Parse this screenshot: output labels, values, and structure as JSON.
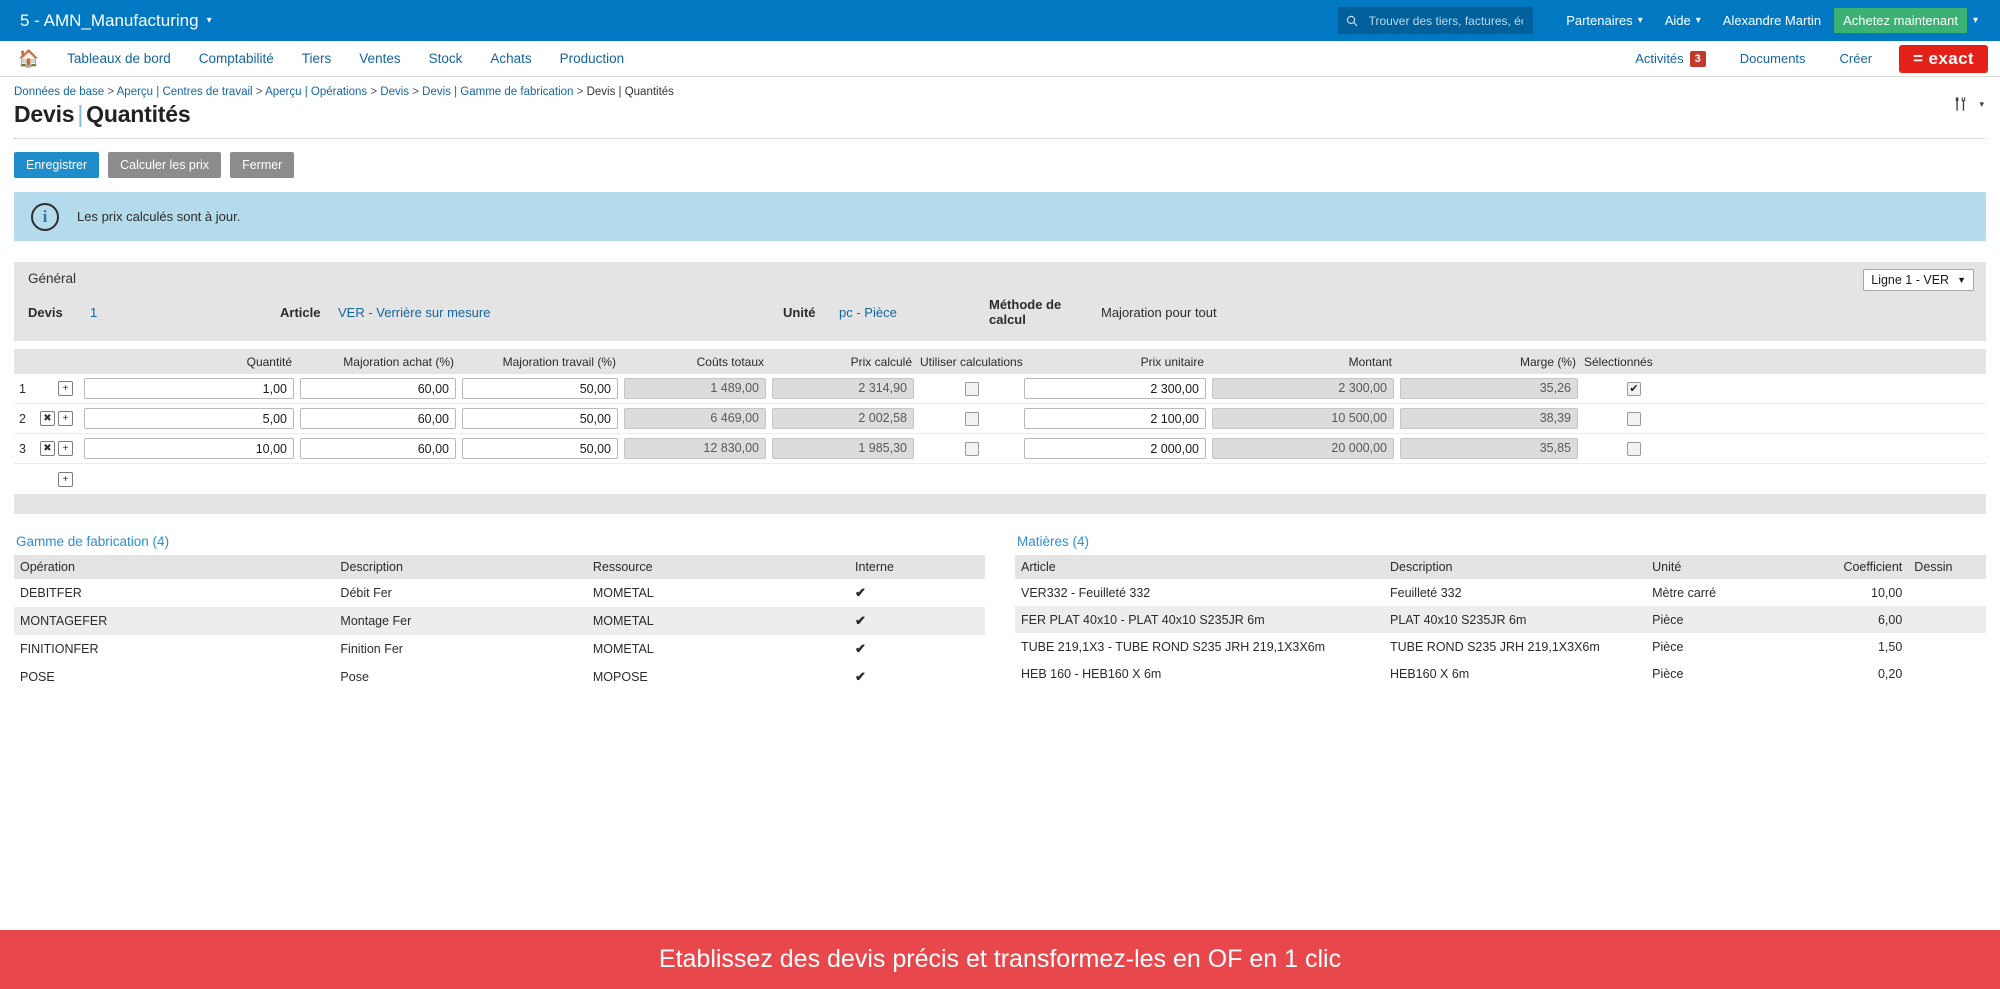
{
  "topbar": {
    "company": "5 - AMN_Manufacturing",
    "company_caret": "chevron-down",
    "search_placeholder": "Trouver des tiers, factures, écr...",
    "search_value": "",
    "partners": "Partenaires",
    "help": "Aide",
    "user": "Alexandre Martin",
    "buy_now": "Achetez maintenant"
  },
  "nav": {
    "items": [
      {
        "label": "Tableaux de bord"
      },
      {
        "label": "Comptabilité"
      },
      {
        "label": "Tiers"
      },
      {
        "label": "Ventes"
      },
      {
        "label": "Stock"
      },
      {
        "label": "Achats"
      },
      {
        "label": "Production"
      }
    ],
    "right": {
      "activities": "Activités",
      "activities_badge": "3",
      "documents": "Documents",
      "create": "Créer",
      "logo": "= exact"
    }
  },
  "breadcrumb": {
    "p1": "Données de base",
    "p2": "Aperçu | Centres de travail",
    "p3": "Aperçu | Opérations",
    "p4": "Devis",
    "p5": "Devis | Gamme de fabrication",
    "current": "Devis | Quantités",
    "sep": ">"
  },
  "title": {
    "part1": "Devis",
    "bar": "|",
    "part2": "Quantités"
  },
  "toolbar": {
    "save": "Enregistrer",
    "calculate": "Calculer les prix",
    "close": "Fermer"
  },
  "notice": {
    "icon": "i",
    "text": "Les prix calculés sont à jour."
  },
  "general": {
    "section_title": "Général",
    "devis_label": "Devis",
    "devis_value": "1",
    "article_label": "Article",
    "article_value": "VER - Verrière sur mesure",
    "unite_label": "Unité",
    "unite_value": "pc - Pièce",
    "methode_label": "Méthode de calcul",
    "methode_value": "Majoration pour tout",
    "line_selector": "Ligne 1 - VER",
    "line_selector_caret": "▼"
  },
  "grid": {
    "headers": {
      "quantite": "Quantité",
      "majoration_achat": "Majoration achat (%)",
      "majoration_travail": "Majoration travail (%)",
      "couts_totaux": "Coûts totaux",
      "prix_calcule": "Prix calculé",
      "utiliser_calculations": "Utiliser calculations",
      "prix_unitaire": "Prix unitaire",
      "montant": "Montant",
      "marge": "Marge (%)",
      "selectionnes": "Sélectionnés"
    },
    "rows": [
      {
        "index": "1",
        "has_delete": false,
        "delete_glyph": "✖",
        "add_glyph": "+",
        "quantite": "1,00",
        "majoration_achat": "60,00",
        "majoration_travail": "50,00",
        "couts_totaux": "1 489,00",
        "prix_calcule": "2 314,90",
        "utiliser_calculations": false,
        "prix_unitaire": "2 300,00",
        "montant": "2 300,00",
        "marge": "35,26",
        "selectionne": true
      },
      {
        "index": "2",
        "has_delete": true,
        "delete_glyph": "✖",
        "add_glyph": "+",
        "quantite": "5,00",
        "majoration_achat": "60,00",
        "majoration_travail": "50,00",
        "couts_totaux": "6 469,00",
        "prix_calcule": "2 002,58",
        "utiliser_calculations": false,
        "prix_unitaire": "2 100,00",
        "montant": "10 500,00",
        "marge": "38,39",
        "selectionne": false
      },
      {
        "index": "3",
        "has_delete": true,
        "delete_glyph": "✖",
        "add_glyph": "+",
        "quantite": "10,00",
        "majoration_achat": "60,00",
        "majoration_travail": "50,00",
        "couts_totaux": "12 830,00",
        "prix_calcule": "1 985,30",
        "utiliser_calculations": false,
        "prix_unitaire": "2 000,00",
        "montant": "20 000,00",
        "marge": "35,85",
        "selectionne": false
      }
    ],
    "add_row_glyph": "+"
  },
  "gamme": {
    "title": "Gamme de fabrication (4)",
    "headers": [
      "Opération",
      "Description",
      "Ressource",
      "Interne"
    ],
    "rows": [
      {
        "operation": "DEBITFER",
        "description": "Débit Fer",
        "ressource": "MOMETAL",
        "interne": "✔"
      },
      {
        "operation": "MONTAGEFER",
        "description": "Montage Fer",
        "ressource": "MOMETAL",
        "interne": "✔"
      },
      {
        "operation": "FINITIONFER",
        "description": "Finition Fer",
        "ressource": "MOMETAL",
        "interne": "✔"
      },
      {
        "operation": "POSE",
        "description": "Pose",
        "ressource": "MOPOSE",
        "interne": "✔"
      }
    ]
  },
  "matieres": {
    "title": "Matières (4)",
    "headers": [
      "Article",
      "Description",
      "Unité",
      "Coefficient",
      "Dessin"
    ],
    "rows": [
      {
        "article": "VER332 - Feuilleté 332",
        "description": "Feuilleté 332",
        "unite": "Mètre carré",
        "coefficient": "10,00",
        "dessin": ""
      },
      {
        "article": "FER PLAT 40x10 - PLAT 40x10 S235JR 6m",
        "description": "PLAT 40x10 S235JR 6m",
        "unite": "Pièce",
        "coefficient": "6,00",
        "dessin": ""
      },
      {
        "article": "TUBE 219,1X3 - TUBE ROND S235 JRH 219,1X3X6m",
        "description": "TUBE ROND S235 JRH 219,1X3X6m",
        "unite": "Pièce",
        "coefficient": "1,50",
        "dessin": ""
      },
      {
        "article": "HEB 160 - HEB160 X 6m",
        "description": "HEB160 X 6m",
        "unite": "Pièce",
        "coefficient": "0,20",
        "dessin": ""
      }
    ]
  },
  "footer": {
    "message": "Etablissez des devis précis et transformez-les en OF en 1 clic"
  },
  "colors": {
    "topbar_blue": "#0079c2",
    "link_blue": "#15659e",
    "primary_button": "#1f8ccc",
    "grey_button": "#8c8c8c",
    "info_bg": "#b3dbec",
    "exact_red": "#e32119",
    "banner_red": "#e8474c",
    "buy_green": "#3bb273",
    "badge_red": "#c0392b",
    "check_green": "#138a1e"
  }
}
